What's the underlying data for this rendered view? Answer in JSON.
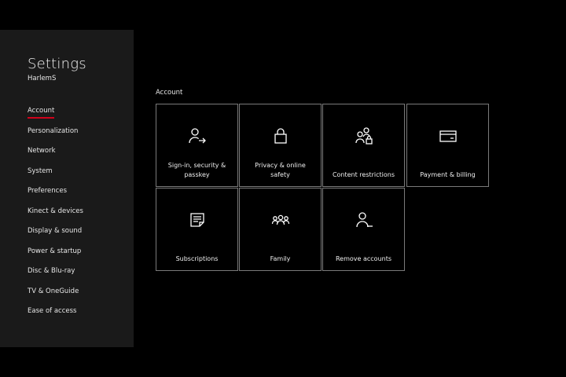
{
  "settings": {
    "title": "Settings",
    "username": "HarlemS"
  },
  "nav": {
    "items": [
      {
        "label": "Account",
        "active": true
      },
      {
        "label": "Personalization"
      },
      {
        "label": "Network"
      },
      {
        "label": "System"
      },
      {
        "label": "Preferences"
      },
      {
        "label": "Kinect & devices"
      },
      {
        "label": "Display & sound"
      },
      {
        "label": "Power & startup"
      },
      {
        "label": "Disc & Blu-ray"
      },
      {
        "label": "TV & OneGuide"
      },
      {
        "label": "Ease of access"
      }
    ]
  },
  "main": {
    "section_label": "Account",
    "tiles": [
      {
        "label_line1": "Sign-in, security &",
        "label_line2": "passkey",
        "icon": "person-arrow-icon"
      },
      {
        "label_line1": "Privacy & online",
        "label_line2": "safety",
        "icon": "lock-icon"
      },
      {
        "label_line1": "",
        "label_line2": "Content restrictions",
        "icon": "people-lock-icon"
      },
      {
        "label_line1": "",
        "label_line2": "Payment & billing",
        "icon": "credit-card-icon"
      },
      {
        "label_line1": "",
        "label_line2": "Subscriptions",
        "icon": "document-icon"
      },
      {
        "label_line1": "",
        "label_line2": "Family",
        "icon": "family-icon"
      },
      {
        "label_line1": "",
        "label_line2": "Remove accounts",
        "icon": "person-remove-icon"
      }
    ]
  },
  "colors": {
    "background": "#000000",
    "sidebar": "#1a1a1a",
    "accent": "#d0021b",
    "tile_border": "#7a7a7a"
  }
}
